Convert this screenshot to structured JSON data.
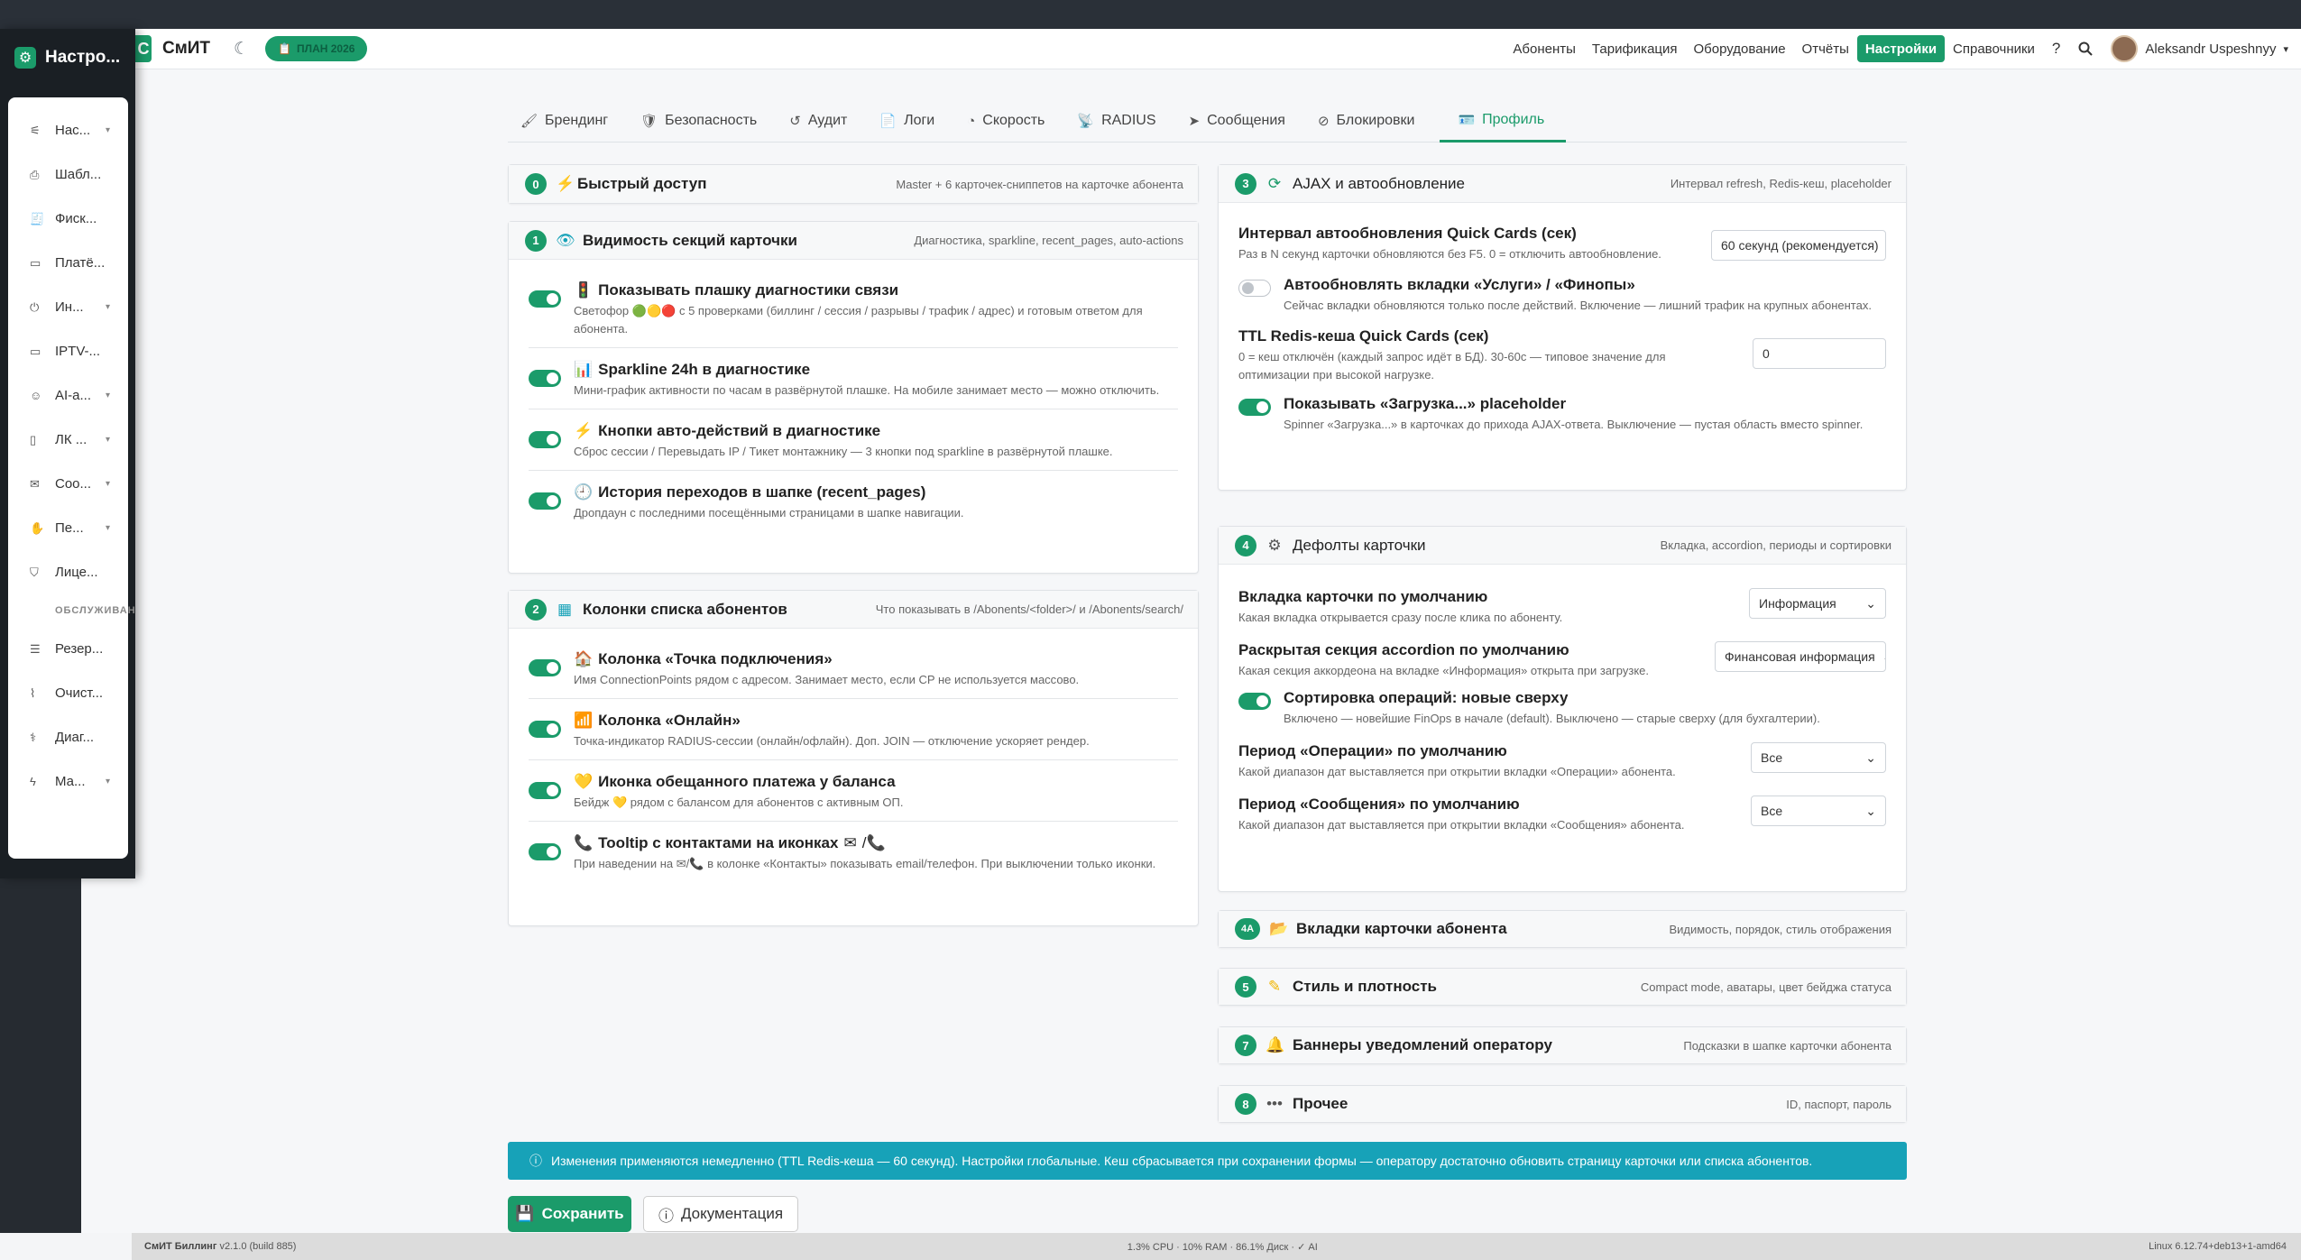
{
  "navbar": {
    "brand_letter": "С",
    "brand_name": "СмИТ",
    "theme_icon": "moon-icon",
    "plan_label": "ПЛАН 2026",
    "links": [
      "Абоненты",
      "Тарификация",
      "Оборудование",
      "Отчёты",
      "Настройки",
      "Справочники"
    ],
    "active_link": "Настройки",
    "user_name": "Aleksandr Uspeshnyy"
  },
  "sidebar": {
    "title": "Настро...",
    "items": [
      {
        "icon": "sliders-icon",
        "label": "Нас...",
        "chevron": true
      },
      {
        "icon": "print-icon",
        "label": "Шабл...",
        "chevron": false
      },
      {
        "icon": "receipt-icon",
        "label": "Фиск...",
        "chevron": false
      },
      {
        "icon": "card-icon",
        "label": "Платё...",
        "chevron": false
      },
      {
        "icon": "plug-icon",
        "label": "Ин...",
        "chevron": true
      },
      {
        "icon": "tv-icon",
        "label": "IPTV-...",
        "chevron": false
      },
      {
        "icon": "robot-icon",
        "label": "AI-а...",
        "chevron": true
      },
      {
        "icon": "mobile-icon",
        "label": "ЛК ...",
        "chevron": true
      },
      {
        "icon": "comment-icon",
        "label": "Соо...",
        "chevron": true
      },
      {
        "icon": "handshake-icon",
        "label": "Пе...",
        "chevron": true
      },
      {
        "icon": "shield-icon",
        "label": "Лице...",
        "chevron": false
      }
    ],
    "section_label": "ОБСЛУЖИВАН",
    "items2": [
      {
        "icon": "database-icon",
        "label": "Резер...",
        "chevron": false
      },
      {
        "icon": "broom-icon",
        "label": "Очист...",
        "chevron": false
      },
      {
        "icon": "stethoscope-icon",
        "label": "Диаг...",
        "chevron": false
      },
      {
        "icon": "bolt-icon",
        "label": "Ма...",
        "chevron": true
      }
    ]
  },
  "tabs": [
    {
      "icon": "brush-icon",
      "glyph": "🖌",
      "label": "Брендинг"
    },
    {
      "icon": "shield-icon",
      "glyph": "🛡",
      "label": "Безопасность"
    },
    {
      "icon": "history-icon",
      "glyph": "↺",
      "label": "Аудит"
    },
    {
      "icon": "file-icon",
      "glyph": "📄",
      "label": "Логи"
    },
    {
      "icon": "gauge-icon",
      "glyph": "◔",
      "label": "Скорость"
    },
    {
      "icon": "tower-icon",
      "glyph": "📡",
      "label": "RADIUS"
    },
    {
      "icon": "paper-plane-icon",
      "glyph": "➤",
      "label": "Сообщения"
    },
    {
      "icon": "ban-icon",
      "glyph": "⊘",
      "label": "Блокировки"
    },
    {
      "icon": "id-card-icon",
      "glyph": "🪪",
      "label": "Профиль"
    }
  ],
  "active_tab": "Профиль",
  "p0": {
    "num": "0",
    "title": "Быстрый доступ",
    "desc": "Master + 6 карточек-сниппетов на карточке абонента"
  },
  "p1": {
    "num": "1",
    "title": "Видимость секций карточки",
    "desc": "Диагностика, sparkline, recent_pages, auto-actions",
    "rows": [
      {
        "title": "Показывать плашку диагностики связи",
        "desc_a": "Светофор",
        "desc_b": "с 5 проверками (биллинг / сессия / разрывы / трафик / адрес) и готовым ответом для абонента."
      },
      {
        "title": "Sparkline 24h в диагностике",
        "desc": "Мини-график активности по часам в развёрнутой плашке. На мобиле занимает место — можно отключить."
      },
      {
        "title": "Кнопки авто-действий в диагностике",
        "desc": "Сброс сессии / Перевыдать IP / Тикет монтажнику — 3 кнопки под sparkline в развёрнутой плашке."
      },
      {
        "title": "История переходов в шапке (recent_pages)",
        "desc": "Дропдаун с последними посещёнными страницами в шапке навигации."
      }
    ]
  },
  "p2": {
    "num": "2",
    "title": "Колонки списка абонентов",
    "desc": "Что показывать в /Abonents/<folder>/ и /Abonents/search/",
    "rows": [
      {
        "title": "Колонка «Точка подключения»",
        "desc": "Имя ConnectionPoints рядом с адресом. Занимает место, если CP не используется массово."
      },
      {
        "title": "Колонка «Онлайн»",
        "desc": "Точка-индикатор RADIUS-сессии (онлайн/офлайн). Доп. JOIN — отключение ускоряет рендер."
      },
      {
        "title": "Иконка обещанного платежа у баланса",
        "desc_a": "Бейдж",
        "desc_b": "рядом с балансом для абонентов с активным ОП."
      },
      {
        "title": "Tooltip с контактами на иконках",
        "desc_a": "При наведении на",
        "desc_b": "в колонке «Контакты» показывать email/телефон. При выключении только иконки."
      }
    ]
  },
  "p3": {
    "num": "3",
    "title": "AJAX и автообновление",
    "desc": "Интервал refresh, Redis-кеш, placeholder",
    "f1_label": "Интервал автообновления Quick Cards (сек)",
    "f1_desc": "Раз в N секунд карточки обновляются без F5. 0 = отключить автообновление.",
    "f1_value": "60 секунд (рекомендуется)",
    "t1_label": "Автообновлять вкладки «Услуги» / «Финопы»",
    "t1_desc": "Сейчас вкладки обновляются только после действий. Включение — лишний трафик на крупных абонентах.",
    "f2_label": "TTL Redis-кеша Quick Cards (сек)",
    "f2_desc": "0 = кеш отключён (каждый запрос идёт в БД). 30-60с — типовое значение для оптимизации при высокой нагрузке.",
    "f2_value": "0",
    "t2_label": "Показывать «Загрузка...» placeholder",
    "t2_desc": "Spinner «Загрузка...» в карточках до прихода AJAX-ответа. Выключение — пустая область вместо spinner."
  },
  "p4": {
    "num": "4",
    "title": "Дефолты карточки",
    "desc": "Вкладка, accordion, периоды и сортировки",
    "f1_label": "Вкладка карточки по умолчанию",
    "f1_desc": "Какая вкладка открывается сразу после клика по абоненту.",
    "f1_value": "Информация",
    "f2_label": "Раскрытая секция accordion по умолчанию",
    "f2_desc": "Какая секция аккордеона на вкладке «Информация» открыта при загрузке.",
    "f2_value": "Финансовая информация",
    "t1_label": "Сортировка операций: новые сверху",
    "t1_desc": "Включено — новейшие FinOps в начале (default). Выключено — старые сверху (для бухгалтерии).",
    "f3_label": "Период «Операции» по умолчанию",
    "f3_desc": "Какой диапазон дат выставляется при открытии вкладки «Операции» абонента.",
    "f3_value": "Все",
    "f4_label": "Период «Сообщения» по умолчанию",
    "f4_desc": "Какой диапазон дат выставляется при открытии вкладки «Сообщения» абонента.",
    "f4_value": "Все"
  },
  "p4a": {
    "num": "4A",
    "title": "Вкладки карточки абонента",
    "desc": "Видимость, порядок, стиль отображения"
  },
  "p5": {
    "num": "5",
    "title": "Стиль и плотность",
    "desc": "Compact mode, аватары, цвет бейджа статуса"
  },
  "p7": {
    "num": "7",
    "title": "Баннеры уведомлений оператору",
    "desc": "Подсказки в шапке карточки абонента"
  },
  "p8": {
    "num": "8",
    "title": "Прочее",
    "desc": "ID, паспорт, пароль"
  },
  "info_text": "Изменения применяются немедленно (TTL Redis-кеша — 60 секунд). Настройки глобальные. Кеш сбрасывается при сохранении формы — оператору достаточно обновить страницу карточки или списка абонентов.",
  "buttons": {
    "save": "Сохранить",
    "docs": "Документация"
  },
  "footer": {
    "app": "СмИТ Биллинг",
    "version": "v2.1.0 (build 885)",
    "stats": "1.3% CPU · 10% RAM · 86.1% Диск · ✓ AI",
    "os": "Linux 6.12.74+deb13+1-amd64"
  },
  "colors": {
    "accent": "#1b9b6a",
    "info": "#17a2b8",
    "sidebar": "#1a1f24"
  }
}
